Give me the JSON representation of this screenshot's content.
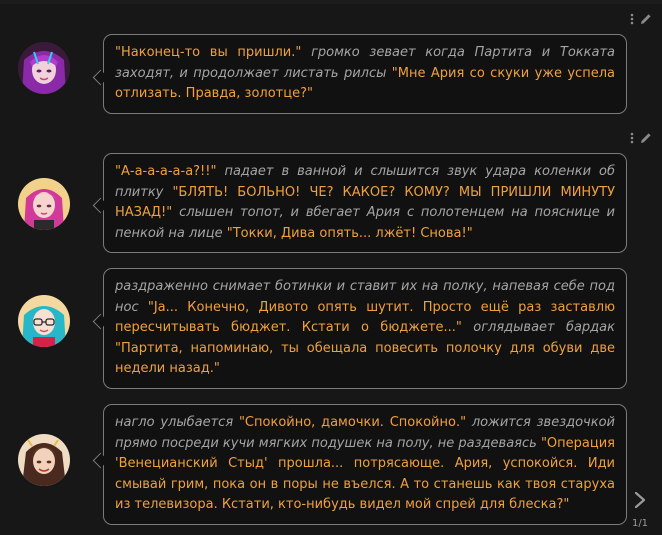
{
  "pager": {
    "text": "1/1"
  },
  "messages": [
    {
      "avatar": "purple-hair-woman-avatar",
      "segments": [
        {
          "kind": "speech",
          "text": "\"Наконец-то вы пришли.\""
        },
        {
          "kind": "action",
          "text": " громко зевает когда Партита и Токката заходят, и продолжает листать рилсы "
        },
        {
          "kind": "speech",
          "text": "\"Мне Ария со скуки уже успела отлизать. Правда, золотце?\""
        }
      ]
    },
    {
      "avatar": "pink-hair-woman-avatar",
      "segments": [
        {
          "kind": "speech",
          "text": "\"А-а-а-а-а-а?!!\""
        },
        {
          "kind": "action",
          "text": " падает в ванной и слышится звук удара коленки об плитку "
        },
        {
          "kind": "speech",
          "text": "\"БЛЯТЬ! БОЛЬНО! ЧЕ? КАКОЕ? КОМУ? МЫ ПРИШЛИ МИНУТУ НАЗАД!\""
        },
        {
          "kind": "action",
          "text": " слышен топот, и вбегает Ария с полотенцем на пояснице и пенкой на лице "
        },
        {
          "kind": "speech",
          "text": "\"Токки, Дива опять... лжёт! Снова!\""
        }
      ]
    },
    {
      "avatar": "teal-hair-glasses-avatar",
      "segments": [
        {
          "kind": "action",
          "text": "раздраженно снимает ботинки и ставит их на полку, напевая себе под нос "
        },
        {
          "kind": "speech",
          "text": "\"Ja... Конечно, Дивото опять шутит. Просто ещё раз заставлю пересчитывать бюджет. Кстати о бюджете...\""
        },
        {
          "kind": "action",
          "text": " оглядывает бардак "
        },
        {
          "kind": "speech",
          "text": "\"Партита, напоминаю, ты обещала повесить полочку для обуви две недели назад.\""
        }
      ]
    },
    {
      "avatar": "brown-hair-woman-avatar",
      "segments": [
        {
          "kind": "action",
          "text": "нагло улыбается "
        },
        {
          "kind": "speech",
          "text": "\"Спокойно, дамочки. Спокойно.\""
        },
        {
          "kind": "action",
          "text": " ложится звездочкой прямо посреди кучи мягких подушек на полу, не раздеваясь "
        },
        {
          "kind": "speech",
          "text": "\"Операция 'Венецианский Стыд' прошла... потрясающе. Ария, успокойся. Иди смывай грим, пока он в поры не въелся. А то станешь как твоя старуха из телевизора. Кстати, кто-нибудь видел мой спрей для блеска?\""
        }
      ]
    }
  ]
}
